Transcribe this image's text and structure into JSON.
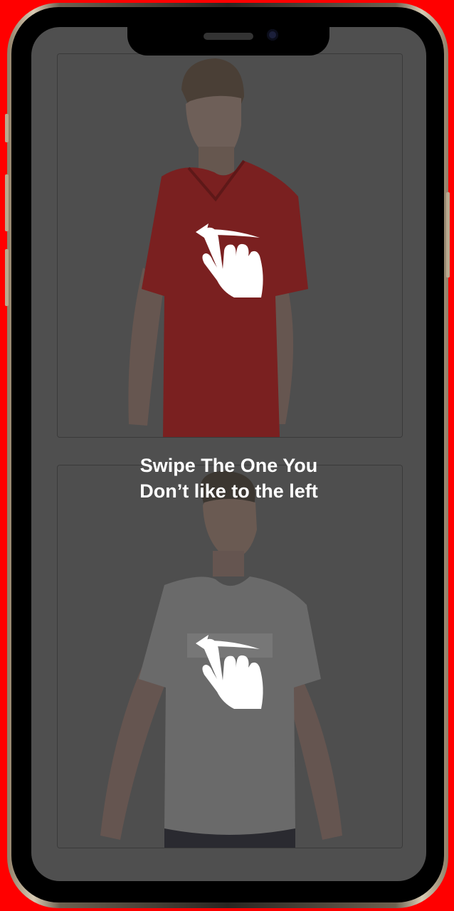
{
  "screen": {
    "caption_line1": "Swipe The One You",
    "caption_line2": "Don’t like to the left"
  },
  "products": [
    {
      "shirt_color": "#7b1f1f",
      "icon": "swipe-left-gesture-icon"
    },
    {
      "shirt_color": "#6f6f6f",
      "icon": "swipe-left-gesture-icon"
    }
  ],
  "colors": {
    "background": "#ff0000",
    "overlay": "#4f4f4f",
    "text": "#ffffff"
  }
}
